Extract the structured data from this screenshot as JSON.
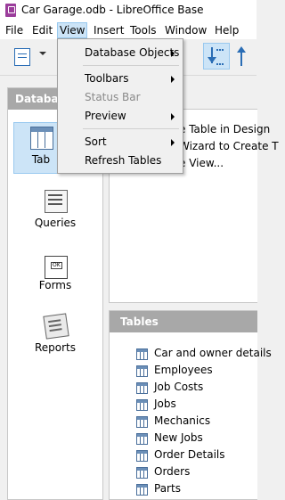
{
  "window": {
    "title": "Car Garage.odb - LibreOffice Base"
  },
  "menubar": [
    "File",
    "Edit",
    "View",
    "Insert",
    "Tools",
    "Window",
    "Help"
  ],
  "view_menu": {
    "items": [
      {
        "label": "Database Objects",
        "submenu": true,
        "enabled": true
      },
      {
        "label": "Toolbars",
        "submenu": true,
        "enabled": true
      },
      {
        "label": "Status Bar",
        "submenu": false,
        "enabled": false
      },
      {
        "label": "Preview",
        "submenu": true,
        "enabled": true
      },
      {
        "label": "Sort",
        "submenu": true,
        "enabled": true
      },
      {
        "label": "Refresh Tables",
        "submenu": false,
        "enabled": true
      }
    ]
  },
  "left_panel": {
    "header": "Databas",
    "items": [
      {
        "label": "Tab",
        "icon": "table-icon",
        "selected": true
      },
      {
        "label": "Queries",
        "icon": "query-icon",
        "selected": false
      },
      {
        "label": "Forms",
        "icon": "form-icon",
        "selected": false
      },
      {
        "label": "Reports",
        "icon": "report-icon",
        "selected": false
      }
    ]
  },
  "tasks": [
    "e Table in Design",
    "Wizard to Create T",
    "e View..."
  ],
  "tables_panel": {
    "header": "Tables",
    "tables": [
      "Car and owner details",
      "Employees",
      "Job Costs",
      "Jobs",
      "Mechanics",
      "New Jobs",
      "Order Details",
      "Orders",
      "Parts"
    ]
  },
  "colors": {
    "selection": "#cce4f7",
    "selection_border": "#99c9ef",
    "panel_header": "#a8a8a8",
    "app_icon": "#9b3d9b"
  }
}
